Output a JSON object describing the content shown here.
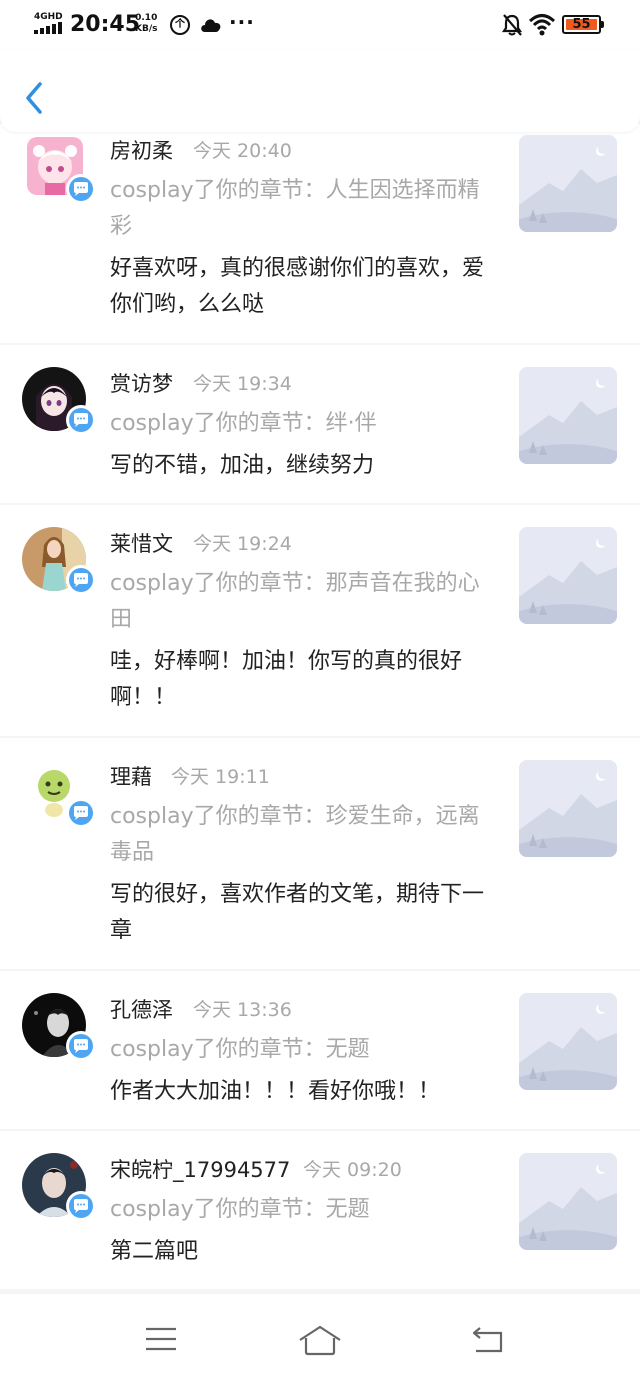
{
  "status_bar": {
    "network": "4GHD",
    "time": "20:45",
    "speed_value": "0.10",
    "speed_unit": "KB/s",
    "circle_icon_text": "个",
    "more": "···",
    "battery": "55",
    "battery_color": "#f05a1e"
  },
  "header": {
    "back_icon": "chevron-left-icon",
    "accent": "#2f8fe0"
  },
  "comments": [
    {
      "name": "房初柔",
      "time": "今天 20:40",
      "chapter": "cosplay了你的章节：人生因选择而精彩",
      "text": "好喜欢呀，真的很感谢你们的喜欢，爱你们哟，么么哒"
    },
    {
      "name": "赏访梦",
      "time": "今天 19:34",
      "chapter": "cosplay了你的章节：绊·伴",
      "text": "写的不错，加油，继续努力"
    },
    {
      "name": "莱惜文",
      "time": "今天 19:24",
      "chapter": "cosplay了你的章节：那声音在我的心田",
      "text": "哇，好棒啊！加油！你写的真的很好啊！！"
    },
    {
      "name": "理藉",
      "time": "今天 19:11",
      "chapter": "cosplay了你的章节：珍爱生命，远离毒品",
      "text": "写的很好，喜欢作者的文笔，期待下一章"
    },
    {
      "name": "孔德泽",
      "time": "今天 13:36",
      "chapter": "cosplay了你的章节：无题",
      "text": "作者大大加油！！！看好你哦！！"
    },
    {
      "name": "宋皖柠_17994577",
      "time": "今天 09:20",
      "chapter": "cosplay了你的章节：无题",
      "text": "第二篇吧"
    }
  ],
  "nav": {
    "menu_icon": "menu-icon",
    "home_icon": "home-icon",
    "back_icon": "return-icon"
  }
}
